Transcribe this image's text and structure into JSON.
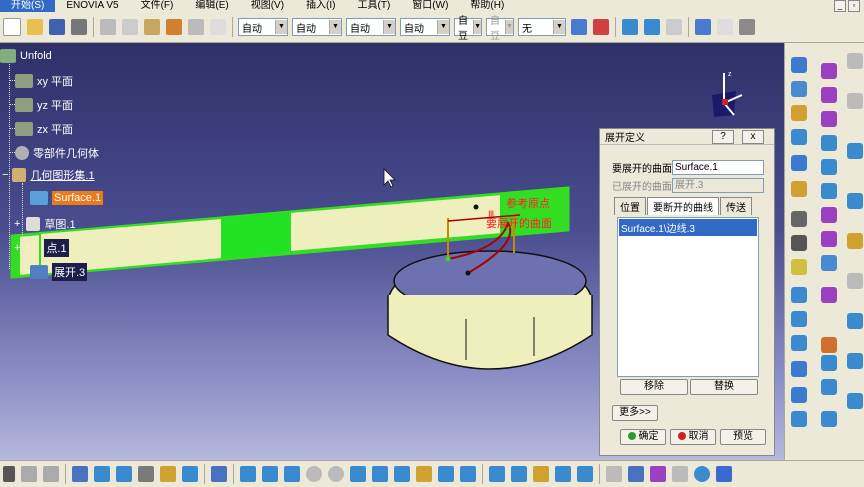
{
  "menu": {
    "items": [
      "开始(S)",
      "ENOVIA V5",
      "文件(F)",
      "编辑(E)",
      "视图(V)",
      "插入(I)",
      "工具(T)",
      "窗口(W)",
      "帮助(H)"
    ]
  },
  "toolbar": {
    "combos": [
      "自动",
      "自动",
      "自动",
      "自动",
      "自豆",
      "自豆",
      "无"
    ]
  },
  "tree": {
    "root": "Unfold",
    "xy": "xy 平面",
    "yz": "yz 平面",
    "zx": "zx 平面",
    "part_body": "零部件几何体",
    "geoset": "几何图形集.1",
    "surface": "Surface.1",
    "sketch": "草图.1",
    "point": "点.1",
    "unfold": "展开.3"
  },
  "model": {
    "label_ref_origin": "参考原点",
    "label_surface": "要展开的曲面",
    "label_points": "Ⅲ"
  },
  "dialog": {
    "title": "展开定义",
    "help": "?",
    "close": "x",
    "surface_label": "要展开的曲面",
    "surface_value": "Surface.1",
    "unfolded_label": "已展开的曲面",
    "unfolded_value": "展开.3",
    "tabs": [
      "位置",
      "要断开的曲线",
      "传送"
    ],
    "list_items": [
      "Surface.1\\边线.3"
    ],
    "remove": "移除",
    "replace": "替换",
    "more": "更多>>",
    "ok": "确定",
    "cancel": "取消",
    "preview": "预览"
  },
  "colors": {
    "background_top": "#2e3068",
    "background_bottom": "#b6b8dc",
    "surface_fill": "#efefbe",
    "highlight_green": "#33dd22",
    "selection_orange": "#e87b1b"
  }
}
